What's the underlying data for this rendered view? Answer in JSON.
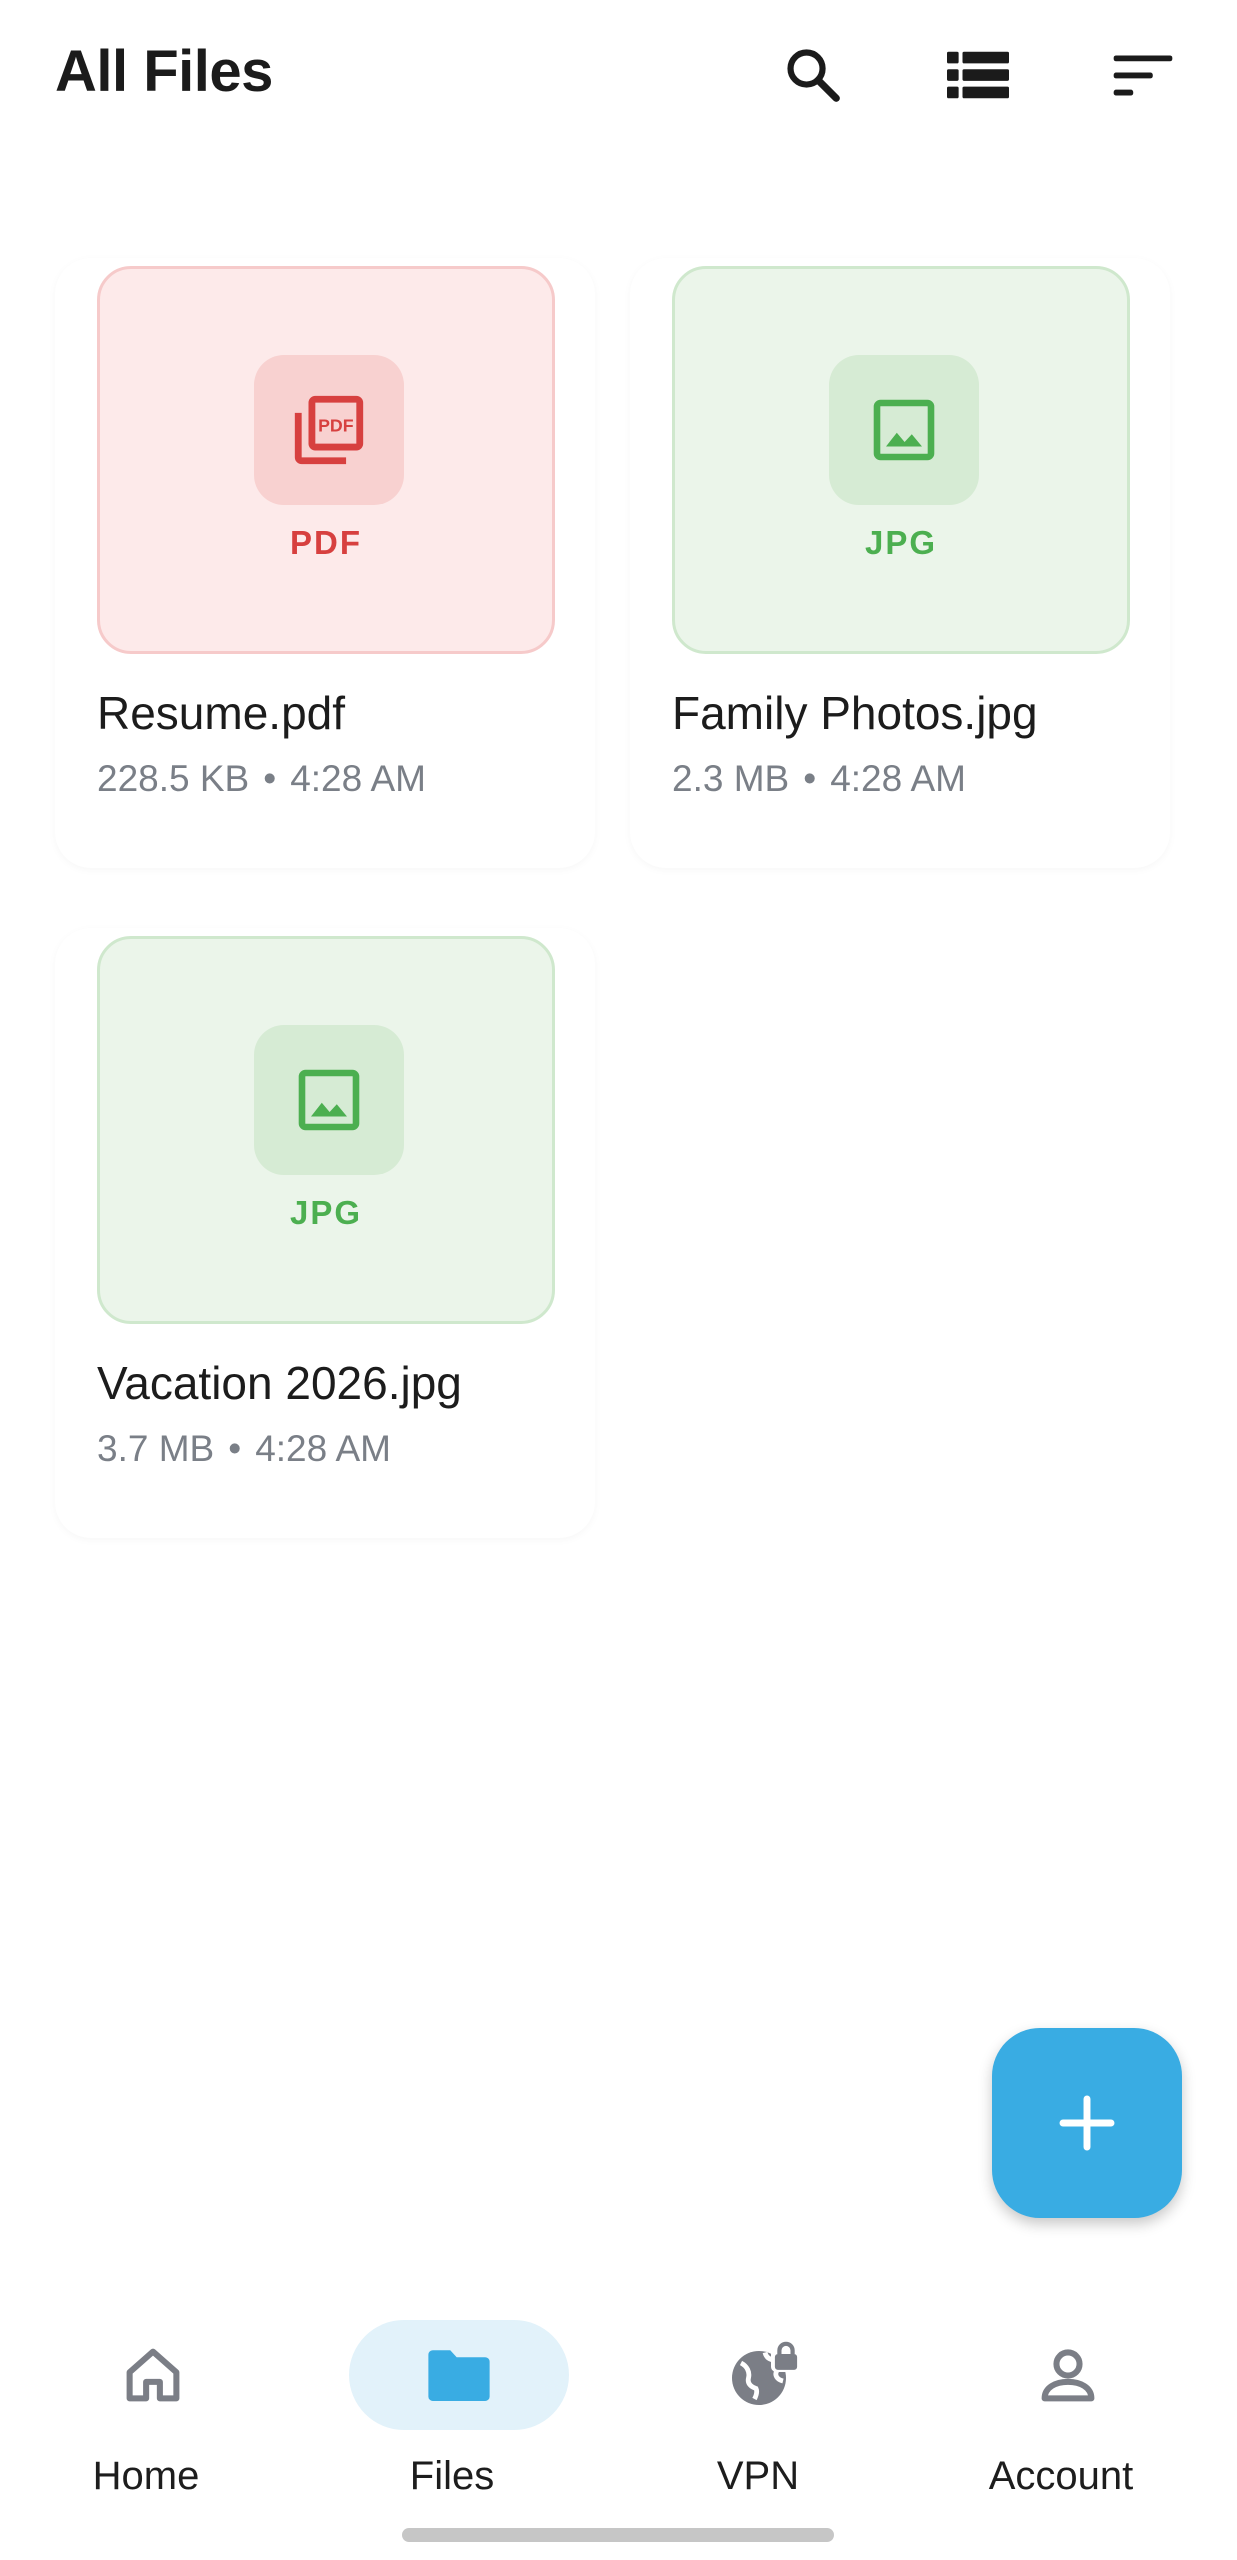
{
  "header": {
    "title": "All Files",
    "search_icon": "search-icon",
    "view_icon": "list-view-icon",
    "sort_icon": "sort-icon"
  },
  "files": [
    {
      "name": "Resume.pdf",
      "type_label": "PDF",
      "size": "228.5 KB",
      "separator": "•",
      "time": "4:28 AM",
      "icon": "pdf-icon"
    },
    {
      "name": "Family Photos.jpg",
      "type_label": "JPG",
      "size": "2.3 MB",
      "separator": "•",
      "time": "4:28 AM",
      "icon": "image-icon"
    },
    {
      "name": "Vacation 2026.jpg",
      "type_label": "JPG",
      "size": "3.7 MB",
      "separator": "•",
      "time": "4:28 AM",
      "icon": "image-icon"
    }
  ],
  "fab": {
    "icon": "plus-icon"
  },
  "nav": {
    "items": [
      {
        "label": "Home",
        "icon": "home-icon",
        "active": false
      },
      {
        "label": "Files",
        "icon": "folder-icon",
        "active": true
      },
      {
        "label": "VPN",
        "icon": "globe-lock-icon",
        "active": false
      },
      {
        "label": "Account",
        "icon": "person-icon",
        "active": false
      }
    ]
  },
  "colors": {
    "accent": "#39ace3",
    "pdf_red": "#d7403f",
    "jpg_green": "#4caf50",
    "nav_active_bg": "#e2f2fa"
  }
}
